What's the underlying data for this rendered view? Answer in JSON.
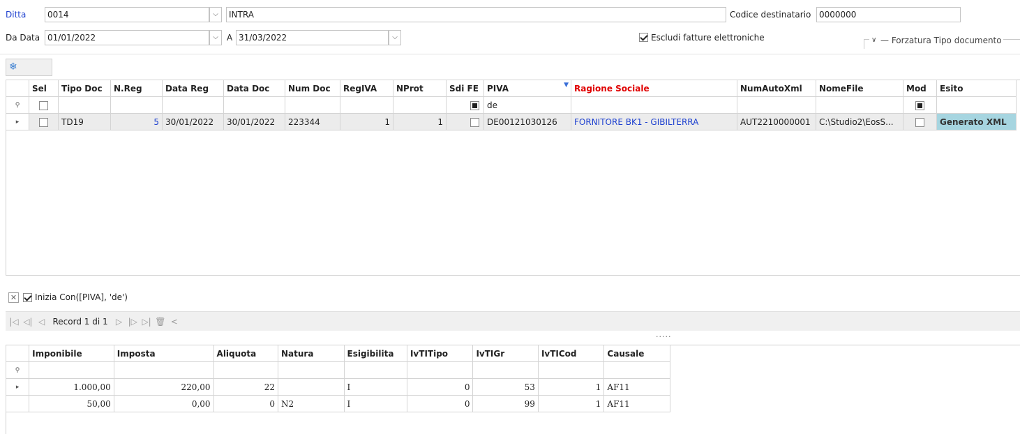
{
  "header": {
    "ditta_label": "Ditta",
    "ditta_value": "0014",
    "ditta_desc": "INTRA",
    "codice_label": "Codice destinatario",
    "codice_value": "0000000",
    "dadata_label": "Da Data",
    "dadata_value": "01/01/2022",
    "a_label": "A",
    "a_value": "31/03/2022",
    "escludi_label": "Escludi fatture elettroniche",
    "forzatura_label": "Forzatura Tipo documento"
  },
  "grid": {
    "columns": [
      "Sel",
      "Tipo Doc",
      "N.Reg",
      "Data Reg",
      "Data Doc",
      "Num Doc",
      "RegIVA",
      "NProt",
      "Sdi FE",
      "PIVA",
      "Ragione Sociale",
      "NumAutoXml",
      "NomeFile",
      "Mod",
      "Esito"
    ],
    "filter_piva": "de",
    "row": {
      "tipo_doc": "TD19",
      "n_reg": "5",
      "data_reg": "30/01/2022",
      "data_doc": "30/01/2022",
      "num_doc": "223344",
      "reg_iva": "1",
      "nprot": "1",
      "piva": "DE00121030126",
      "ragione_sociale": "FORNITORE BK1 - GIBILTERRA",
      "num_auto_xml": "AUT2210000001",
      "nome_file": "C:\\Studio2\\EosS...",
      "esito": "Generato XML"
    }
  },
  "filter_bar": {
    "expression": "Inizia Con([PIVA], 'de')"
  },
  "navigator": {
    "record_text": "Record 1 di 1"
  },
  "splitter": {
    "dots": "....."
  },
  "detail": {
    "columns": [
      "Imponibile",
      "Imposta",
      "Aliquota",
      "Natura",
      "Esigibilita",
      "IvTITipo",
      "IvTIGr",
      "IvTICod",
      "Causale"
    ],
    "rows": [
      [
        "1.000,00",
        "220,00",
        "22",
        "",
        "I",
        "0",
        "53",
        "1",
        "AF11"
      ],
      [
        "50,00",
        "0,00",
        "0",
        "N2",
        "I",
        "0",
        "99",
        "1",
        "AF11"
      ]
    ]
  },
  "colors": {
    "link_blue": "#1c3fcf",
    "required_red": "#e00000",
    "esito_bg": "#a6d5e0"
  }
}
